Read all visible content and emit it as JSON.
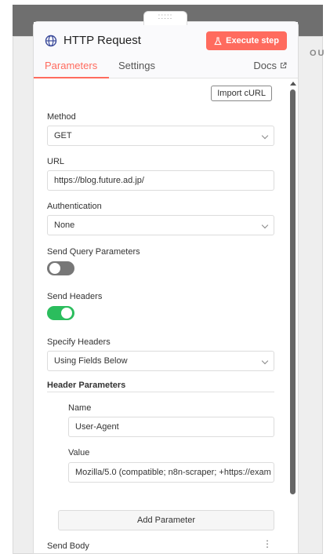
{
  "background": {
    "side_label": "OU"
  },
  "drag_handle": ":::::",
  "header": {
    "title": "HTTP Request",
    "execute_label": "Execute step",
    "tabs": [
      {
        "label": "Parameters",
        "active": true
      },
      {
        "label": "Settings",
        "active": false
      }
    ],
    "docs_label": "Docs"
  },
  "params": {
    "import_curl": "Import cURL",
    "method": {
      "label": "Method",
      "value": "GET"
    },
    "url": {
      "label": "URL",
      "value": "https://blog.future.ad.jp/"
    },
    "authentication": {
      "label": "Authentication",
      "value": "None"
    },
    "send_query": {
      "label": "Send Query Parameters",
      "enabled": false
    },
    "send_headers": {
      "label": "Send Headers",
      "enabled": true
    },
    "specify_headers": {
      "label": "Specify Headers",
      "value": "Using Fields Below"
    },
    "header_parameters": {
      "label": "Header Parameters",
      "name_label": "Name",
      "name_value": "User-Agent",
      "value_label": "Value",
      "value_value": "Mozilla/5.0 (compatible; n8n-scraper; +https://exam"
    },
    "add_parameter": "Add Parameter",
    "send_body": {
      "label": "Send Body"
    }
  },
  "colors": {
    "accent": "#ff6b5e",
    "toggle_on": "#2bbd5d",
    "toggle_off": "#777777"
  },
  "icons": {
    "title": "globe-icon",
    "execute": "flask-icon",
    "docs": "external-link-icon"
  }
}
